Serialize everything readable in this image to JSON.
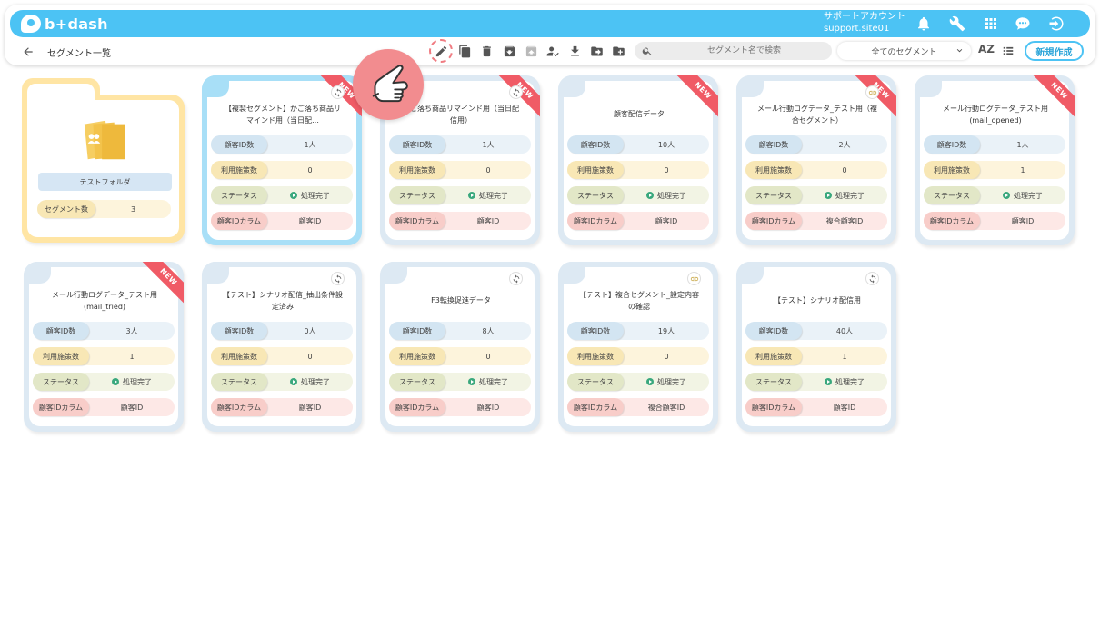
{
  "app": {
    "logo_text": "b+dash"
  },
  "account": {
    "name": "サポートアカウント",
    "site": "support.site01"
  },
  "header": {
    "title": "セグメント一覧"
  },
  "search": {
    "placeholder": "セグメント名で検索"
  },
  "filter": {
    "selected": "全てのセグメント"
  },
  "sort_label": "AZ",
  "new_button": "新規作成",
  "labels": {
    "customer_count": "顧客ID数",
    "usage": "利用施策数",
    "status": "ステータス",
    "column": "顧客IDカラム",
    "segment_count": "セグメント数"
  },
  "folder": {
    "name": "テストフォルダ",
    "segment_count": "3"
  },
  "badge": "NEW",
  "cards_row1": [
    {
      "name": "【複製セグメント】かご落ち商品リマインド用（当日配…",
      "count": "1人",
      "usage": "0",
      "status": "処理完了",
      "column": "顧客ID",
      "is_new": true,
      "icon": "sync-icon"
    },
    {
      "name": "かご落ち商品リマインド用（当日配信用）",
      "count": "1人",
      "usage": "0",
      "status": "処理完了",
      "column": "顧客ID",
      "is_new": true,
      "icon": "sync-icon"
    },
    {
      "name": "顧客配信データ",
      "count": "10人",
      "usage": "0",
      "status": "処理完了",
      "column": "顧客ID",
      "is_new": true,
      "icon": "sync-icon"
    },
    {
      "name": "メール行動ログデータ_テスト用（複合セグメント）",
      "count": "2人",
      "usage": "0",
      "status": "処理完了",
      "column": "複合顧客ID",
      "is_new": true,
      "icon": "link-icon"
    },
    {
      "name": "メール行動ログデータ_テスト用(mail_opened)",
      "count": "1人",
      "usage": "1",
      "status": "処理完了",
      "column": "顧客ID",
      "is_new": true,
      "icon": "sync-icon"
    }
  ],
  "cards_row2": [
    {
      "name": "メール行動ログデータ_テスト用(mail_tried)",
      "count": "3人",
      "usage": "1",
      "status": "処理完了",
      "column": "顧客ID",
      "is_new": true,
      "icon": "sync-icon"
    },
    {
      "name": "【テスト】シナリオ配信_抽出条件設定済み",
      "count": "0人",
      "usage": "0",
      "status": "処理完了",
      "column": "顧客ID",
      "is_new": false,
      "icon": "sync-icon"
    },
    {
      "name": "F3転換促進データ",
      "count": "8人",
      "usage": "0",
      "status": "処理完了",
      "column": "顧客ID",
      "is_new": false,
      "icon": "sync-icon"
    },
    {
      "name": "【テスト】複合セグメント_設定内容の確認",
      "count": "19人",
      "usage": "0",
      "status": "処理完了",
      "column": "複合顧客ID",
      "is_new": false,
      "icon": "link-icon"
    },
    {
      "name": "【テスト】シナリオ配信用",
      "count": "40人",
      "usage": "1",
      "status": "処理完了",
      "column": "顧客ID",
      "is_new": false,
      "icon": "sync-icon"
    }
  ],
  "colors": {
    "brand": "#4cc3f4",
    "ribbon": "#f05b66",
    "status_ok": "#3aa87d",
    "folder": "#ffe5a4"
  }
}
